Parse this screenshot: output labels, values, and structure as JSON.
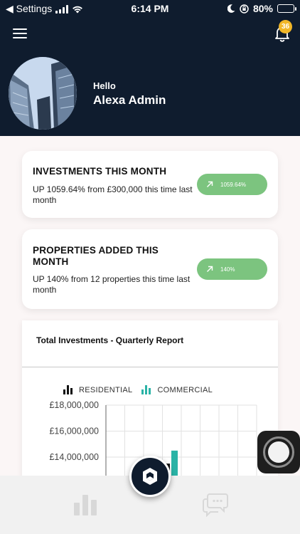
{
  "status_bar": {
    "back_label": "◀ Settings",
    "time": "6:14 PM",
    "battery": "80%",
    "battery_fraction": 0.8
  },
  "header": {
    "notification_count": "36",
    "greeting": "Hello",
    "user_name": "Alexa Admin"
  },
  "cards": [
    {
      "title": "INVESTMENTS THIS MONTH",
      "description": "UP 1059.64% from £300,000 this time last month",
      "badge": "1059.64%"
    },
    {
      "title": "PROPERTIES ADDED THIS MONTH",
      "description": "UP 140% from 12 properties this time last month",
      "badge": "140%"
    }
  ],
  "chart": {
    "title": "Total Investments - Quarterly Report",
    "legend": [
      "RESIDENTIAL",
      "COMMERCIAL"
    ]
  },
  "chart_data": {
    "type": "bar",
    "title": "Total Investments - Quarterly Report",
    "series": [
      {
        "name": "RESIDENTIAL",
        "color": "#111111",
        "values": [
          13500000
        ]
      },
      {
        "name": "COMMERCIAL",
        "color": "#2ab3a6",
        "values": [
          14500000
        ]
      }
    ],
    "y_tick_labels": [
      "£18,000,000",
      "£16,000,000",
      "£14,000,000"
    ],
    "ylim": [
      12000000,
      18000000
    ],
    "grid": true
  },
  "colors": {
    "header_bg": "#0f1c2e",
    "pill_green": "#7cc47f",
    "badge_yellow": "#f2b728",
    "commercial_teal": "#2ab3a6"
  },
  "icons": {
    "menu": "hamburger-icon",
    "notifications": "bell-icon",
    "trend": "arrow-up-right-icon",
    "tab_stats": "bar-chart-icon",
    "tab_chat": "chat-icon",
    "home": "logo-icon"
  }
}
